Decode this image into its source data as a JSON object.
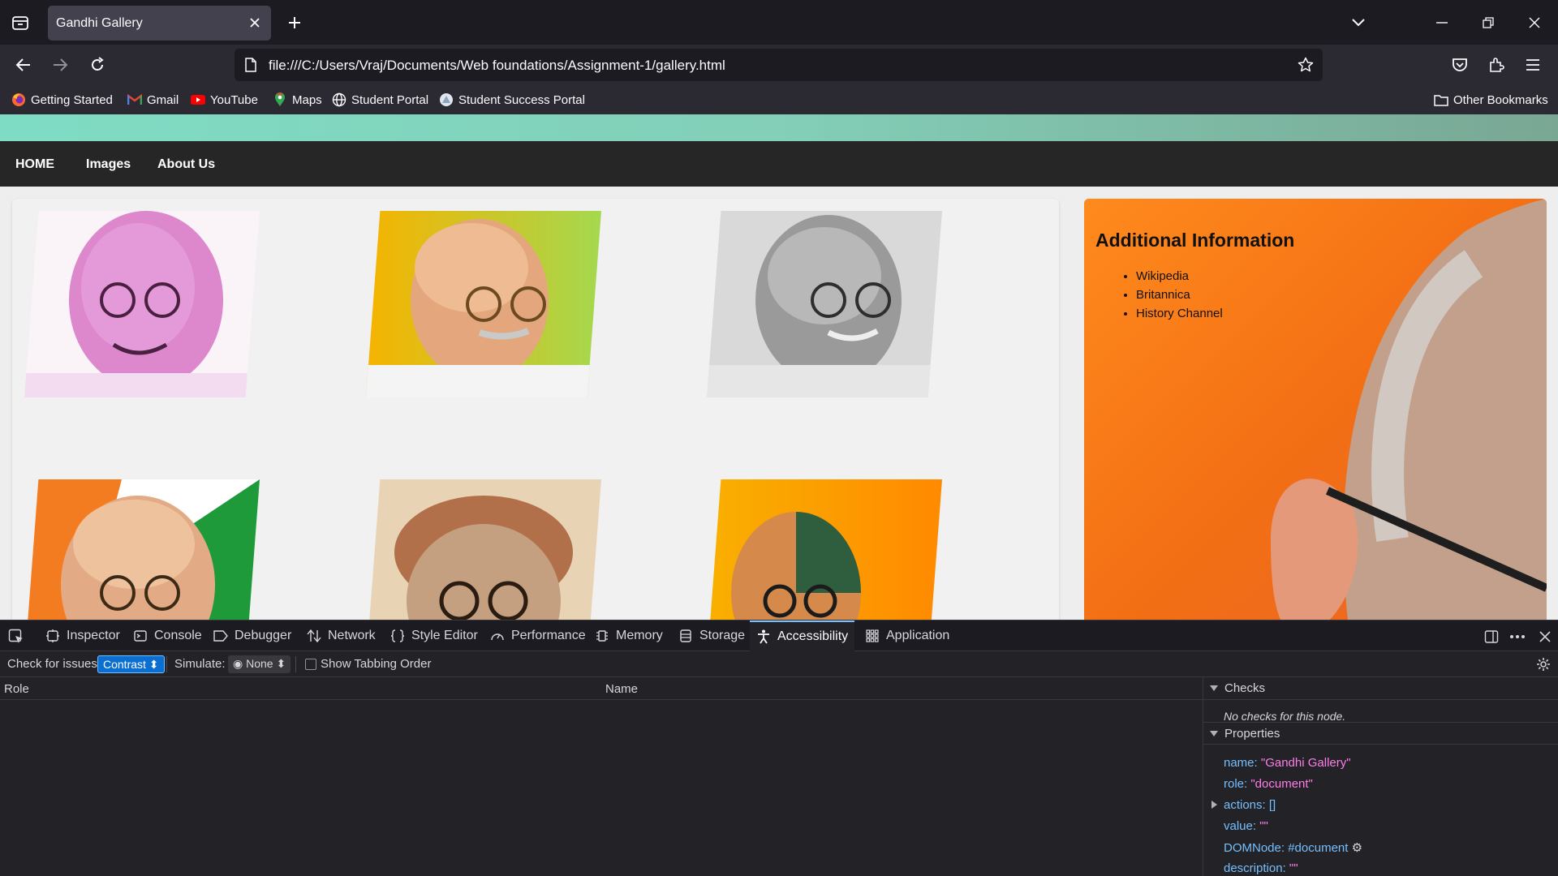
{
  "browser": {
    "tab_title": "Gandhi Gallery",
    "url": "file:///C:/Users/Vraj/Documents/Web foundations/Assignment-1/gallery.html",
    "bookmarks": [
      {
        "label": "Getting Started",
        "icon": "firefox-icon"
      },
      {
        "label": "Gmail",
        "icon": "gmail-icon"
      },
      {
        "label": "YouTube",
        "icon": "youtube-icon"
      },
      {
        "label": "Maps",
        "icon": "maps-icon"
      },
      {
        "label": "Student Portal",
        "icon": "globe-icon"
      },
      {
        "label": "Student Success Portal",
        "icon": "portal-icon"
      }
    ],
    "other_bookmarks": "Other Bookmarks"
  },
  "site": {
    "nav": [
      "HOME",
      "Images",
      "About Us"
    ],
    "aside_title": "Additional Information",
    "links": [
      "Wikipedia",
      "Britannica",
      "History Channel"
    ]
  },
  "devtools": {
    "tabs": [
      "Inspector",
      "Console",
      "Debugger",
      "Network",
      "Style Editor",
      "Performance",
      "Memory",
      "Storage",
      "Accessibility",
      "Application"
    ],
    "active_tab": "Accessibility",
    "check_label": "Check for issues:",
    "check_value": "Contrast",
    "simulate_label": "Simulate:",
    "simulate_value": "None",
    "tabbing_label": "Show Tabbing Order",
    "col_role": "Role",
    "col_name": "Name",
    "checks_title": "Checks",
    "no_checks": "No checks for this node.",
    "properties_title": "Properties",
    "props": {
      "name_k": "name:",
      "name_v": "\"Gandhi Gallery\"",
      "role_k": "role:",
      "role_v": "\"document\"",
      "actions_k": "actions:",
      "actions_v": "[]",
      "value_k": "value:",
      "value_v": "\"\"",
      "dom_k": "DOMNode:",
      "dom_v": "#document",
      "desc_k": "description:",
      "desc_v": "\"\""
    }
  },
  "colors": {
    "accent": "#75bfff",
    "prop_value": "#ff7de9",
    "site_nav": "#262626",
    "hero": "#7fdcc4"
  }
}
